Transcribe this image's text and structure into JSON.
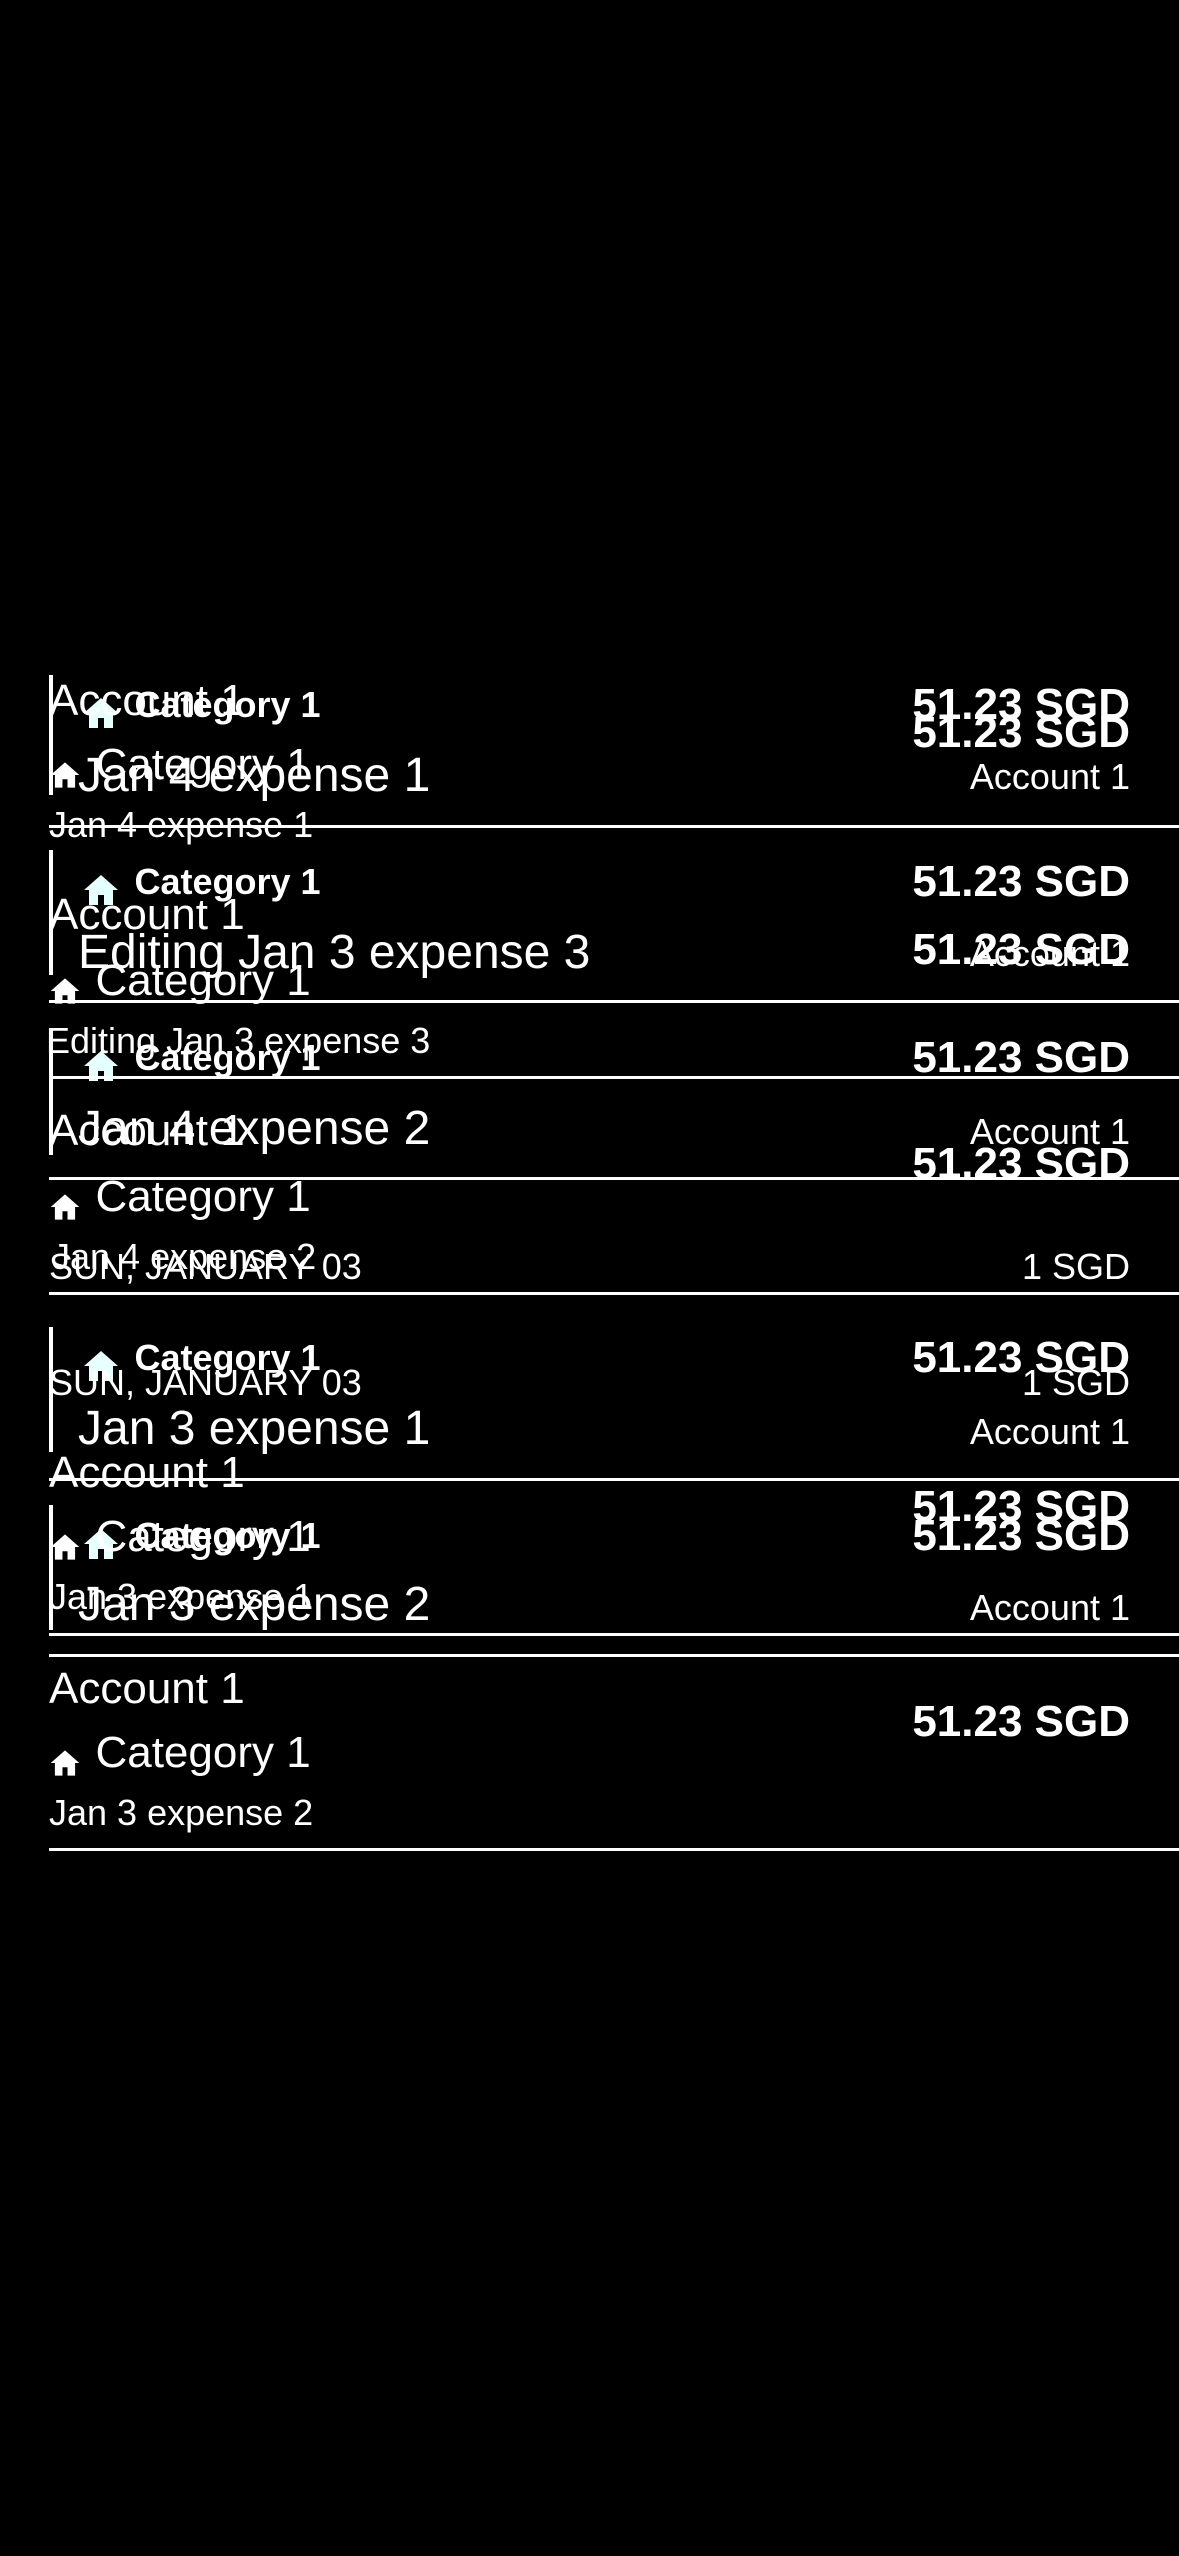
{
  "expenses": [
    {
      "category": "Category 1",
      "title": "Jan 4 expense 1",
      "amount": "51.23 SGD",
      "account": "Account 1"
    },
    {
      "category": "Category 1",
      "title": "Editing Jan 3 expense 3",
      "amount": "51.23 SGD",
      "account": "Account 1"
    },
    {
      "category": "Category 1",
      "title": "Jan 4 expense 2",
      "amount": "51.23 SGD",
      "account": "Account 1"
    },
    {
      "category": "Category 1",
      "title": "Jan 3 expense 1",
      "amount": "51.23 SGD",
      "account": "Account 1"
    },
    {
      "category": "Category 1",
      "title": "Jan 3 expense 2",
      "amount": "51.23 SGD",
      "account": "Account 1"
    }
  ],
  "day_header": {
    "date": "SUN, JANUARY 03",
    "total": "1 SGD"
  },
  "ghost_rows": [
    {
      "account": "Account 1",
      "category": "Category 1",
      "title": "Jan 4 expense 1",
      "amount": "51.23 SGD"
    },
    {
      "account": "Account 1",
      "category": "Category 1",
      "title": "Editing Jan 3 expense 3",
      "amount": "51.23 SGD"
    },
    {
      "account": "Account 1",
      "category": "Category 1",
      "title": "Jan 4 expense 2",
      "amount": "51.23 SGD"
    },
    {
      "account": "Account 1",
      "category": "Category 1",
      "title": "Jan 3 expense 1",
      "amount": "51.23 SGD"
    },
    {
      "account": "Account 1",
      "category": "Category 1",
      "title": "Jan 3 expense 2",
      "amount": "51.23 SGD"
    }
  ],
  "icons": {
    "category_icon": "house-icon"
  },
  "colors": {
    "background": "#000000",
    "text": "#ffffff",
    "icon": "#e6ffff"
  }
}
